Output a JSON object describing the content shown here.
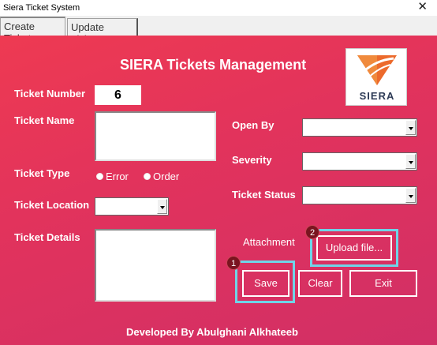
{
  "window": {
    "title": "Siera Ticket System",
    "close_glyph": "✕"
  },
  "tabs": [
    {
      "label": "Create Ticket",
      "active": true
    },
    {
      "label": "Update Ticket",
      "active": false
    }
  ],
  "form": {
    "heading": "SIERA Tickets Management",
    "logo_text": "SIERA",
    "labels": {
      "ticket_number": "Ticket Number",
      "ticket_name": "Ticket Name",
      "ticket_type": "Ticket Type",
      "ticket_location": "Ticket Location",
      "ticket_details": "Ticket Details",
      "open_by": "Open By",
      "severity": "Severity",
      "ticket_status": "Ticket Status",
      "attachment": "Attachment"
    },
    "ticket_number_value": "6",
    "ticket_type_options": [
      "Error",
      "Order"
    ],
    "buttons": {
      "upload": "Upload file...",
      "save": "Save",
      "clear": "Clear",
      "exit": "Exit"
    },
    "step_badges": [
      "1",
      "2"
    ]
  },
  "footer": "Developed By Abulghani Alkhateeb",
  "colors": {
    "background_top": "#ee3a52",
    "background_bottom": "#d12f66",
    "highlight": "#6fd4e8",
    "badge": "#7a1420"
  }
}
